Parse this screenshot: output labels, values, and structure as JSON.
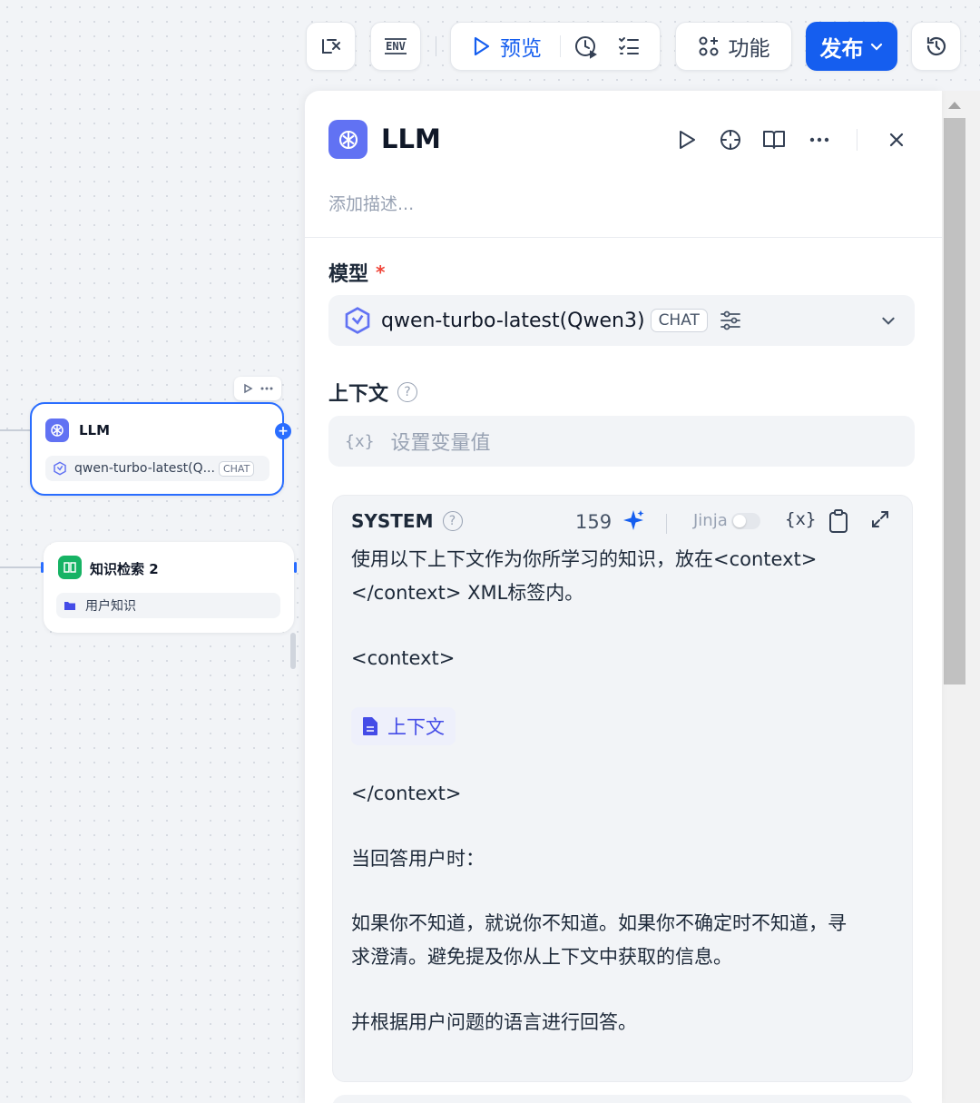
{
  "toolbar": {
    "variables_icon": "variable-icon",
    "env_label": "ENV",
    "preview_label": "预览",
    "function_label": "功能",
    "publish_label": "发布",
    "history_icon": "history-icon"
  },
  "canvas": {
    "llm_node": {
      "title": "LLM",
      "model": "qwen-turbo-latest(Q...",
      "chip": "CHAT"
    },
    "kb_node": {
      "title": "知识检索 2",
      "item": "用户知识"
    }
  },
  "panel": {
    "title": "LLM",
    "description_placeholder": "添加描述...",
    "model_label": "模型",
    "required_mark": "*",
    "model_name": "qwen-turbo-latest(Qwen3)",
    "model_chip": "CHAT",
    "context_label": "上下文",
    "context_placeholder": "设置变量值",
    "context_var_glyph": "{x}",
    "system": {
      "label": "SYSTEM",
      "count": "159",
      "jinja_label": "Jinja",
      "var_glyph": "{x}",
      "lines": [
        "使用以下上下文作为你所学习的知识，放在<context>",
        "</context> XML标签内。",
        "<context>",
        "</context>",
        "当回答用户时：",
        "如果你不知道，就说你不知道。如果你不确定时不知道，寻",
        "求澄清。避免提及你从上下文中获取的信息。",
        "并根据用户问题的语言进行回答。"
      ],
      "context_tag": "上下文"
    }
  },
  "colors": {
    "accent": "#155eef",
    "llm_icon": "#6172f3",
    "kb_icon": "#16b364"
  }
}
